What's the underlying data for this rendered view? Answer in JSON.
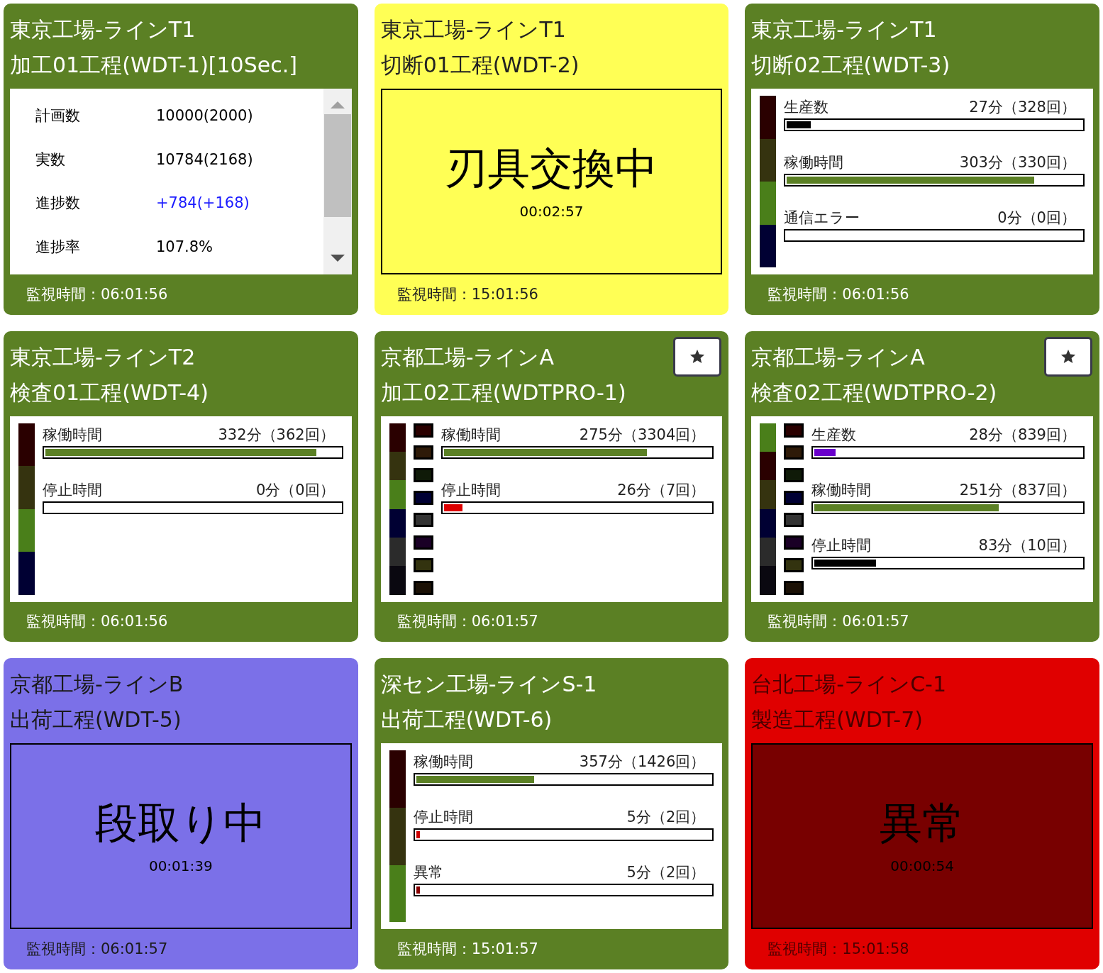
{
  "cards": [
    {
      "kind": "running",
      "title": [
        "東京工場-ラインT1",
        "加工01工程(WDT-1)[10Sec.]"
      ],
      "starred": false,
      "rows": [
        {
          "label": "計画数",
          "value": "10000(2000)",
          "highlight": false
        },
        {
          "label": "実数",
          "value": "10784(2168)",
          "highlight": false
        },
        {
          "label": "進捗数",
          "value": "+784(+168)",
          "highlight": true
        },
        {
          "label": "進捗率",
          "value": "107.8%",
          "highlight": false
        }
      ],
      "footer": "監視時間：06:01:56"
    },
    {
      "kind": "tool_change",
      "title": [
        "東京工場-ラインT1",
        "切断01工程(WDT-2)"
      ],
      "starred": false,
      "state": {
        "label": "刃具交換中",
        "timer": "00:02:57"
      },
      "footer": "監視時間：15:01:56"
    },
    {
      "kind": "running",
      "title": [
        "東京工場-ラインT1",
        "切断02工程(WDT-3)"
      ],
      "starred": false,
      "strip": [
        {
          "color": "#2a0000"
        },
        {
          "color": "#35330f"
        },
        {
          "color": "#4a7f1a"
        },
        {
          "color": "#000033"
        }
      ],
      "bars": [
        {
          "label": "生産数",
          "reading": "27分（328回）",
          "level": 0.08,
          "color": "#000000"
        },
        {
          "label": "稼働時間",
          "reading": "303分（330回）",
          "level": 0.84,
          "color": "#5b8024"
        },
        {
          "label": "通信エラー",
          "reading": "0分（0回）"
        }
      ],
      "footer": "監視時間：06:01:56"
    },
    {
      "kind": "running",
      "title": [
        "東京工場-ラインT2",
        "検査01工程(WDT-4)"
      ],
      "starred": false,
      "strip": [
        {
          "color": "#2a0000"
        },
        {
          "color": "#35330f"
        },
        {
          "color": "#4a7f1a"
        },
        {
          "color": "#000033"
        }
      ],
      "bars": [
        {
          "label": "稼働時間",
          "reading": "332分（362回）",
          "level": 0.92,
          "color": "#5b8024"
        },
        {
          "label": "停止時間",
          "reading": "0分（0回）"
        }
      ],
      "footer": "監視時間：06:01:56"
    },
    {
      "kind": "running",
      "title": [
        "京都工場-ラインA",
        "加工02工程(WDTPRO-1)"
      ],
      "starred": true,
      "strip": [
        {
          "color": "#2a0000"
        },
        {
          "color": "#35330f"
        },
        {
          "color": "#4a7f1a"
        },
        {
          "color": "#000033"
        },
        {
          "color": "#2b2b2b"
        },
        {
          "color": "#0a0810"
        }
      ],
      "swatches": [
        {
          "color": "#2a0000"
        },
        {
          "color": "#2e1a08"
        },
        {
          "color": "#0f1a08"
        },
        {
          "color": "#000033"
        },
        {
          "color": "#333333"
        },
        {
          "color": "#1a0026"
        },
        {
          "color": "#33330f"
        },
        {
          "color": "#1a1005"
        }
      ],
      "bars": [
        {
          "label": "稼働時間",
          "reading": "275分（3304回）",
          "level": 0.76,
          "color": "#5b8024"
        },
        {
          "label": "停止時間",
          "reading": "26分（7回）",
          "level": 0.07,
          "color": "#dd0000"
        }
      ],
      "footer": "監視時間：06:01:57"
    },
    {
      "kind": "running",
      "title": [
        "京都工場-ラインA",
        "検査02工程(WDTPRO-2)"
      ],
      "starred": true,
      "strip": [
        {
          "color": "#4a7f1a"
        },
        {
          "color": "#2a0000"
        },
        {
          "color": "#35330f"
        },
        {
          "color": "#000033"
        },
        {
          "color": "#2b2b2b"
        },
        {
          "color": "#0a0810"
        }
      ],
      "swatches": [
        {
          "color": "#2a0000"
        },
        {
          "color": "#2e1a08"
        },
        {
          "color": "#0f1a08"
        },
        {
          "color": "#000033"
        },
        {
          "color": "#333333"
        },
        {
          "color": "#1a0026"
        },
        {
          "color": "#33330f"
        },
        {
          "color": "#1a1005"
        }
      ],
      "bars": [
        {
          "label": "生産数",
          "reading": "28分（839回）",
          "level": 0.08,
          "color": "#6a00cc"
        },
        {
          "label": "稼働時間",
          "reading": "251分（837回）",
          "level": 0.69,
          "color": "#5b8024"
        },
        {
          "label": "停止時間",
          "reading": "83分（10回）",
          "level": 0.23,
          "color": "#000000"
        }
      ],
      "footer": "監視時間：06:01:57"
    },
    {
      "kind": "setup",
      "title": [
        "京都工場-ラインB",
        "出荷工程(WDT-5)"
      ],
      "starred": false,
      "state": {
        "label": "段取り中",
        "timer": "00:01:39"
      },
      "footer": "監視時間：06:01:57"
    },
    {
      "kind": "running",
      "title": [
        "深セン工場-ラインS-1",
        "出荷工程(WDT-6)"
      ],
      "starred": false,
      "strip": [
        {
          "color": "#2a0000"
        },
        {
          "color": "#35330f"
        },
        {
          "color": "#4a7f1a"
        }
      ],
      "bars": [
        {
          "label": "稼働時間",
          "reading": "357分（1426回）",
          "level": 0.4,
          "color": "#5b8024"
        },
        {
          "label": "停止時間",
          "reading": "5分（2回）",
          "level": 0.012,
          "color": "#cc0000"
        },
        {
          "label": "異常",
          "reading": "5分（2回）",
          "level": 0.012,
          "color": "#880000"
        }
      ],
      "footer": "監視時間：15:01:57"
    },
    {
      "kind": "alarm",
      "title": [
        "台北工場-ラインC-1",
        "製造工程(WDT-7)"
      ],
      "starred": false,
      "state": {
        "label": "異常",
        "timer": "00:00:54"
      },
      "footer": "監視時間：15:01:58"
    }
  ]
}
